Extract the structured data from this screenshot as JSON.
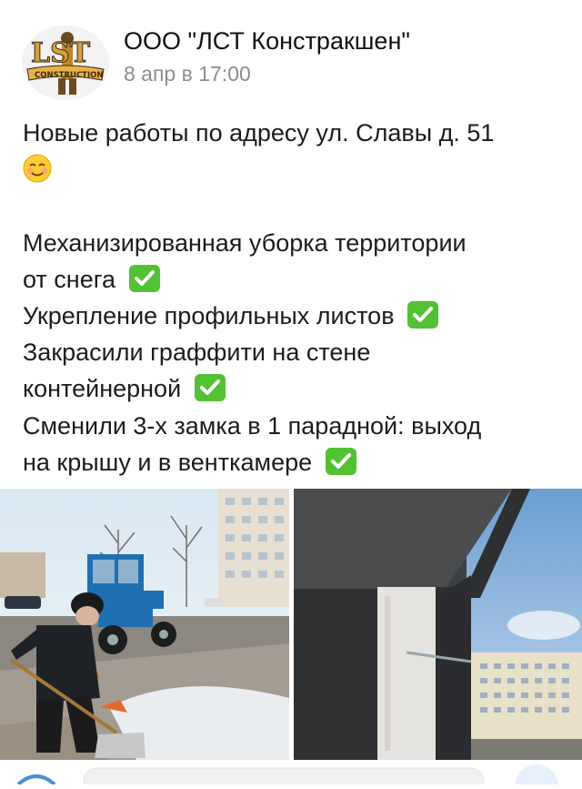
{
  "post": {
    "author": "ООО \"ЛСТ Констракшен\"",
    "date": "8 апр в 17:00",
    "lines": [
      "Новые работы по адресу ул. Славы д. 51",
      "",
      "",
      "Механизированная уборка территории",
      "от снега",
      "Укрепление профильных листов",
      "Закрасили граффити на стене",
      "контейнерной",
      "Сменили 3-х замка в 1 парадной: выход",
      "на крышу и в венткамере"
    ],
    "logo": {
      "text": "LST",
      "subtext": "CONSTRUCTION"
    }
  },
  "icons": {
    "smile": "smiling-face-emoji",
    "check": "check-mark-button-emoji"
  },
  "colors": {
    "text": "#1c1c1c",
    "meta": "#8a8d91",
    "check_green": "#52c234",
    "tractor_blue": "#1f6fb3"
  }
}
